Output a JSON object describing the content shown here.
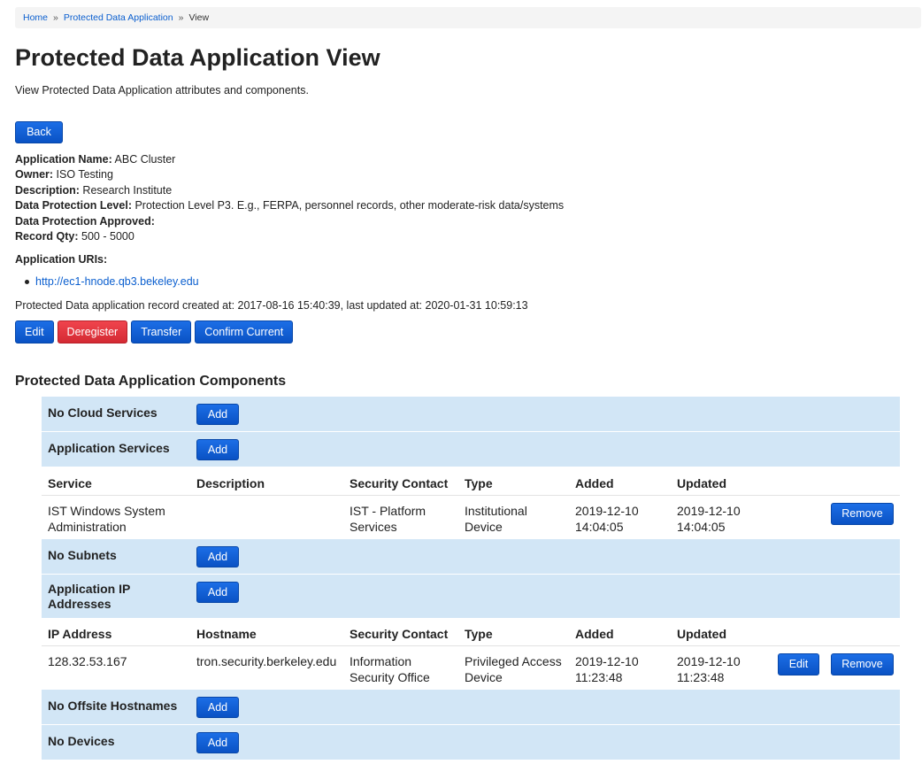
{
  "breadcrumb": {
    "home": "Home",
    "section": "Protected Data Application",
    "current": "View",
    "separator": "»"
  },
  "page": {
    "title": "Protected Data Application View",
    "subtitle": "View Protected Data Application attributes and components.",
    "back_label": "Back"
  },
  "attributes": [
    {
      "label": "Application Name:",
      "value": "ABC Cluster"
    },
    {
      "label": "Owner:",
      "value": "ISO Testing"
    },
    {
      "label": "Description:",
      "value": "Research Institute"
    },
    {
      "label": "Data Protection Level:",
      "value": "Protection Level P3. E.g., FERPA, personnel records, other moderate-risk data/systems"
    },
    {
      "label": "Data Protection Approved:",
      "value": ""
    },
    {
      "label": "Record Qty:",
      "value": "500 - 5000"
    }
  ],
  "uris": {
    "title": "Application URIs:",
    "items": [
      "http://ec1-hnode.qb3.bekeley.edu"
    ]
  },
  "record_line": "Protected Data application record created at: 2017-08-16 15:40:39, last updated at: 2020-01-31 10:59:13",
  "actions": {
    "edit": "Edit",
    "deregister": "Deregister",
    "transfer": "Transfer",
    "confirm": "Confirm Current"
  },
  "components": {
    "title": "Protected Data Application Components",
    "add_label": "Add",
    "edit_label": "Edit",
    "remove_label": "Remove",
    "cloud_services": "No Cloud Services",
    "app_services": "Application Services",
    "services_headers": [
      "Service",
      "Description",
      "Security Contact",
      "Type",
      "Added",
      "Updated"
    ],
    "services_rows": [
      {
        "service": "IST Windows System Administration",
        "description": "",
        "contact": "IST - Platform Services",
        "type": "Institutional Device",
        "added": "2019-12-10 14:04:05",
        "updated": "2019-12-10 14:04:05"
      }
    ],
    "subnets": "No Subnets",
    "ip_addresses": "Application IP Addresses",
    "ip_headers": [
      "IP Address",
      "Hostname",
      "Security Contact",
      "Type",
      "Added",
      "Updated"
    ],
    "ip_rows": [
      {
        "ip": "128.32.53.167",
        "hostname": "tron.security.berkeley.edu",
        "contact": "Information Security Office",
        "type": "Privileged Access Device",
        "added": "2019-12-10 11:23:48",
        "updated": "2019-12-10 11:23:48"
      }
    ],
    "offsite": "No Offsite Hostnames",
    "devices": "No Devices"
  },
  "colors": {
    "primary": "#0a52c4",
    "danger": "#d42a33",
    "section_bg": "#d2e6f6",
    "link": "#0b5fcf"
  }
}
